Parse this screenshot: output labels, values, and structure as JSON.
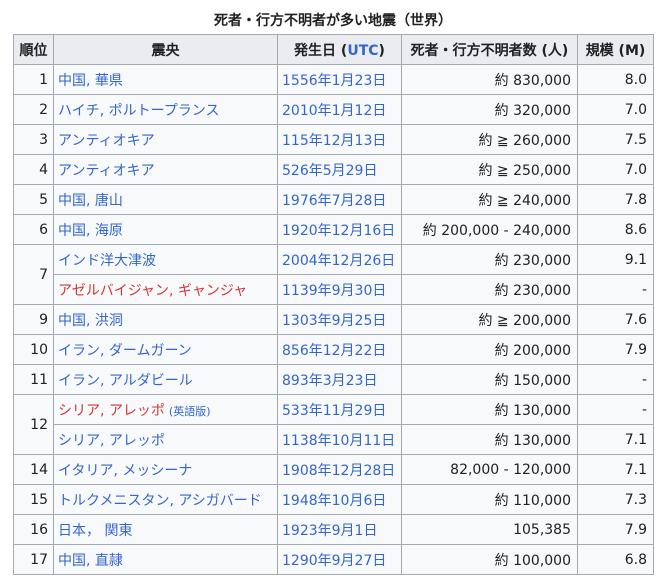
{
  "caption": "死者・行方不明者が多い地震（世界）",
  "headers": {
    "rank": "順位",
    "epicenter": "震央",
    "date_prefix": "発生日 (",
    "date_link": "UTC",
    "date_suffix": ")",
    "deaths": "死者・行方不明者数 (人)",
    "magnitude": "規模 (M)"
  },
  "rows": [
    {
      "rank": "1",
      "place": "中国, 華県",
      "date": "1556年1月23日",
      "deaths": "約 830,000",
      "mag": "8.0"
    },
    {
      "rank": "2",
      "place": "ハイチ, ポルトープランス",
      "date": "2010年1月12日",
      "deaths": "約 320,000",
      "mag": "7.0"
    },
    {
      "rank": "3",
      "place": "アンティオキア",
      "date": "115年12月13日",
      "deaths": "約 ≧ 260,000",
      "mag": "7.5"
    },
    {
      "rank": "4",
      "place": "アンティオキア",
      "date": "526年5月29日",
      "deaths": "約 ≧ 250,000",
      "mag": "7.0"
    },
    {
      "rank": "5",
      "place": "中国, 唐山",
      "date": "1976年7月28日",
      "deaths": "約 ≧ 240,000",
      "mag": "7.8"
    },
    {
      "rank": "6",
      "place": "中国, 海原",
      "date": "1920年12月16日",
      "deaths": "約 200,000 - 240,000",
      "mag": "8.6"
    },
    {
      "rank": "7",
      "place": "インド洋大津波",
      "date": "2004年12月26日",
      "deaths": "約 230,000",
      "mag": "9.1"
    },
    {
      "rank": "",
      "place": "アゼルバイジャン, ギャンジャ",
      "date": "1139年9月30日",
      "deaths": "約 230,000",
      "mag": "-"
    },
    {
      "rank": "9",
      "place": "中国, 洪洞",
      "date": "1303年9月25日",
      "deaths": "約 ≧ 200,000",
      "mag": "7.6"
    },
    {
      "rank": "10",
      "place": "イラン, ダームガーン",
      "date": "856年12月22日",
      "deaths": "約 200,000",
      "mag": "7.9"
    },
    {
      "rank": "11",
      "place": "イラン, アルダビール",
      "date": "893年3月23日",
      "deaths": "約 150,000",
      "mag": "-"
    },
    {
      "rank": "12",
      "place": "シリア, アレッポ",
      "place_note": "(英語版)",
      "date": "533年11月29日",
      "deaths": "約 130,000",
      "mag": "-"
    },
    {
      "rank": "",
      "place": "シリア, アレッポ",
      "date": "1138年10月11日",
      "deaths": "約 130,000",
      "mag": "7.1"
    },
    {
      "rank": "14",
      "place": "イタリア, メッシーナ",
      "date": "1908年12月28日",
      "deaths": "82,000 - 120,000",
      "mag": "7.1"
    },
    {
      "rank": "15",
      "place": "トルクメニスタン, アシガバード",
      "date": "1948年10月6日",
      "deaths": "約 110,000",
      "mag": "7.3"
    },
    {
      "rank": "16",
      "place": "日本， 関東",
      "date": "1923年9月1日",
      "deaths": "105,385",
      "mag": "7.9"
    },
    {
      "rank": "17",
      "place": "中国, 直隷",
      "date": "1290年9月27日",
      "deaths": "約 100,000",
      "mag": "6.8"
    }
  ],
  "colors": {
    "link": "#3366cc",
    "redlink": "#d73333",
    "header_bg": "#eaecf0",
    "cell_bg": "#f8f9fa",
    "border": "#a2a9b1"
  }
}
